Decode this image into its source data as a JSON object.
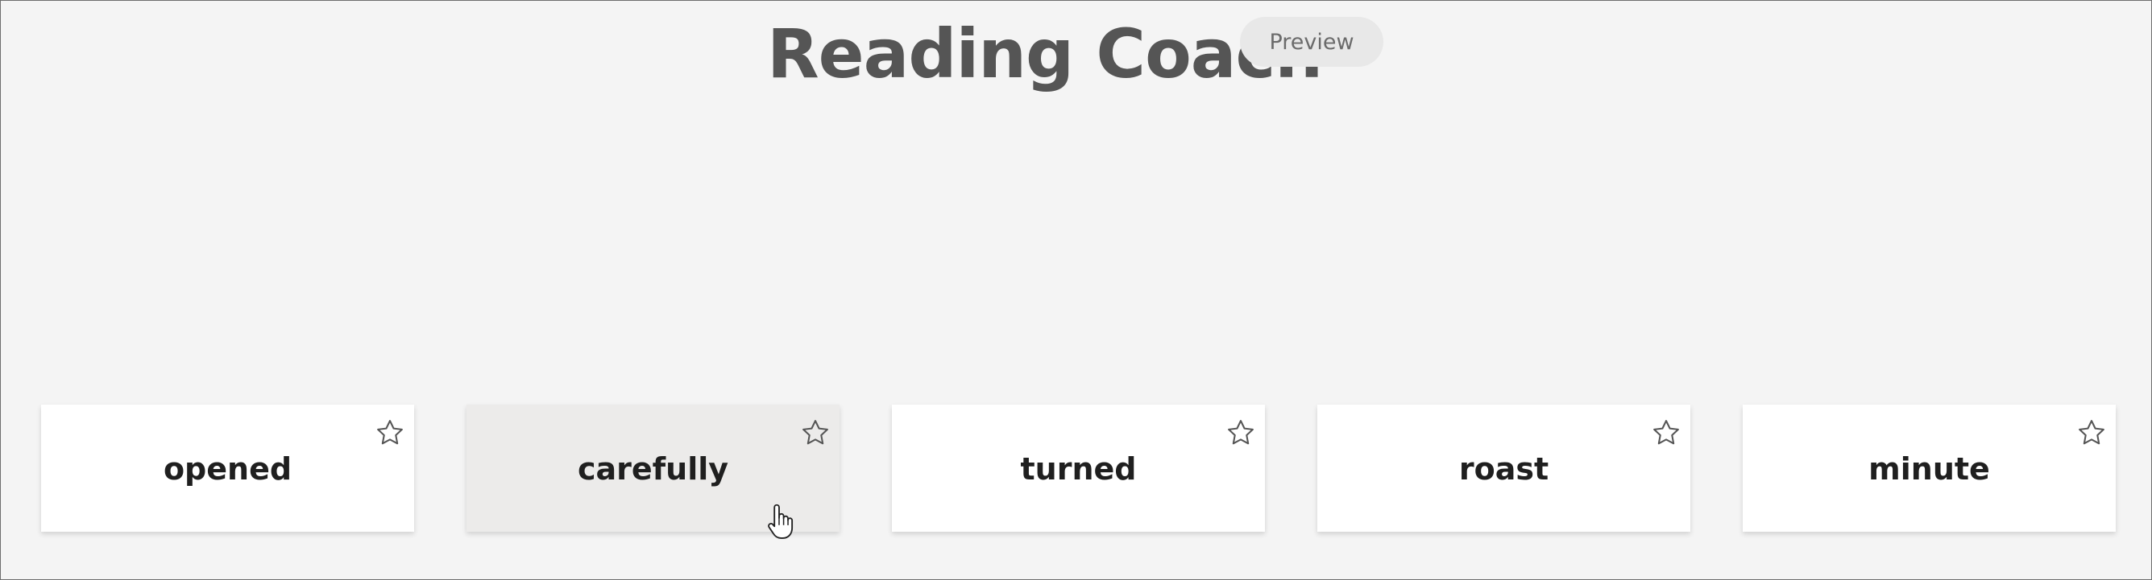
{
  "header": {
    "title": "Reading Coach",
    "badge": "Preview"
  },
  "words": [
    {
      "text": "opened",
      "hovered": false
    },
    {
      "text": "carefully",
      "hovered": true
    },
    {
      "text": "turned",
      "hovered": false
    },
    {
      "text": "roast",
      "hovered": false
    },
    {
      "text": "minute",
      "hovered": false
    }
  ],
  "icons": {
    "favorite": "star-outline-icon",
    "cursor": "hand-pointer-icon"
  },
  "colors": {
    "background": "#f4f4f4",
    "title": "#555555",
    "card": "#ffffff",
    "card_hover": "#ecebea",
    "badge_bg": "#e8e8e8"
  }
}
